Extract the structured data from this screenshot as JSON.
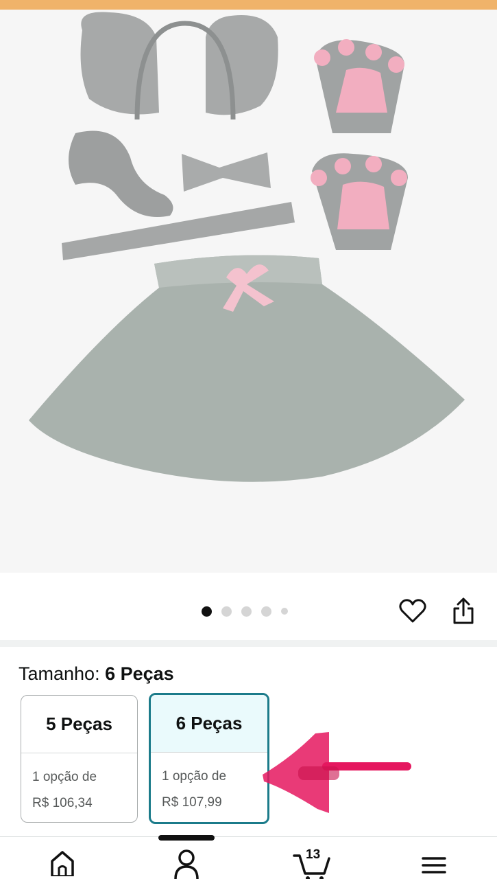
{
  "product_image": {
    "alt": "Elephant costume set: headband with ears, trunk, bow tie, tail, paw gloves and grey tutu skirt"
  },
  "gallery": {
    "total_images": 5,
    "active_index": 1
  },
  "icons": {
    "favorite": "heart-icon",
    "share": "share-icon",
    "home": "home-icon",
    "account": "person-icon",
    "cart": "cart-icon",
    "menu": "menu-icon"
  },
  "size": {
    "label": "Tamanho: ",
    "selected": "6 Peças",
    "options": [
      {
        "name": "5 Peças",
        "offers": "1 opção de",
        "price": "R$ 106,34",
        "selected": false
      },
      {
        "name": "6 Peças",
        "offers": "1 opção de",
        "price": "R$ 107,99",
        "selected": true
      }
    ]
  },
  "nav": {
    "cart_count": "13"
  },
  "colors": {
    "accent": "#1b7b8a",
    "selected_bg": "#eafafc",
    "annotation": "#e5175f"
  }
}
